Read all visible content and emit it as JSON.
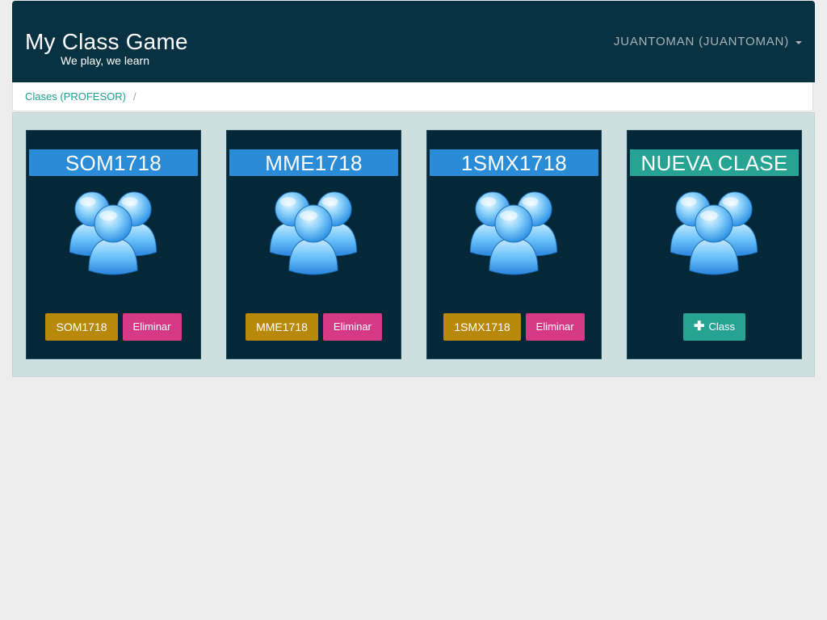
{
  "header": {
    "brand": "My Class Game",
    "tagline": "We play, we learn",
    "user_menu": "JUANTOMAN (JUANTOMAN)"
  },
  "breadcrumb": {
    "link": "Clases (PROFESOR)",
    "separator": "/"
  },
  "classes": [
    {
      "title": "SOM1718",
      "open_label": "SOM1718",
      "delete_label": "Eliminar"
    },
    {
      "title": "MME1718",
      "open_label": "MME1718",
      "delete_label": "Eliminar"
    },
    {
      "title": "1SMX1718",
      "open_label": "1SMX1718",
      "delete_label": "Eliminar"
    }
  ],
  "new_class": {
    "title": "NUEVA CLASE",
    "add_label": "Class",
    "add_icon": "plus-icon"
  },
  "colors": {
    "navbar": "#083241",
    "card": "#052838",
    "title_blue": "#2a8bd7",
    "title_teal": "#27a394",
    "btn_gold": "#b8880a",
    "btn_pink": "#d63a86",
    "btn_teal": "#27a394"
  }
}
